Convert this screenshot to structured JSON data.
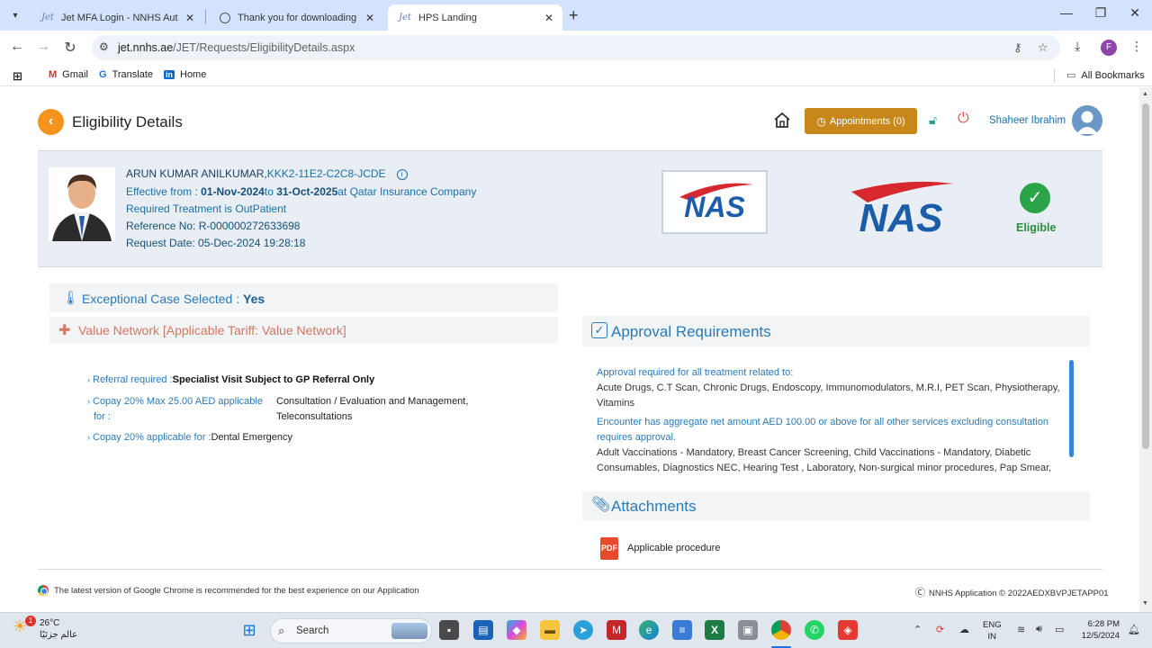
{
  "browser": {
    "tabs": [
      {
        "label": "Jet MFA Login - NNHS Authenti",
        "favicon": "jet-icon"
      },
      {
        "label": "Thank you for downloading An",
        "favicon": "globe-icon"
      },
      {
        "label": "HPS Landing",
        "favicon": "jet-icon",
        "active": true
      }
    ],
    "url_host": "jet.nnhs.ae",
    "url_path": "/JET/Requests/EligibilityDetails.aspx",
    "profile_initial": "F",
    "bookmarks": [
      {
        "label": "Gmail",
        "icon": "gmail-icon"
      },
      {
        "label": "Translate",
        "icon": "translate-icon"
      },
      {
        "label": "Home",
        "icon": "linkedin-icon"
      }
    ],
    "all_bookmarks": "All Bookmarks"
  },
  "header": {
    "title": "Eligibility Details",
    "appointments_label": "Appointments (0)",
    "user_name": "Shaheer Ibrahim"
  },
  "patient": {
    "name": "ARUN KUMAR ANILKUMAR,",
    "card_id": "KKK2-11E2-C2C8-JCDE",
    "effective_prefix": "Effective from : ",
    "effective_from": "01-Nov-2024",
    "to_word": "to ",
    "effective_to": "31-Oct-2025",
    "insurer": "at Qatar Insurance Company",
    "treatment": "Required Treatment is OutPatient",
    "reference": "Reference No: R-000000272633698",
    "request_date": "Request Date: 05-Dec-2024 19:28:18",
    "logo_text": "NAS",
    "status": "Eligible"
  },
  "exceptional": {
    "label": "Exceptional Case Selected : ",
    "value": "Yes"
  },
  "value_network": {
    "label": "Value Network [Applicable Tariff: Value Network]"
  },
  "rules": [
    {
      "label": "Referral required :",
      "value": "Specialist Visit Subject to GP Referral Only"
    },
    {
      "label_line1": "Copay 20% Max 25.00 AED applicable",
      "label_line2": "for :",
      "value_line1": "Consultation / Evaluation and Management,",
      "value_line2": "Teleconsultations"
    },
    {
      "label": "Copay 20% applicable for :",
      "value": "Dental Emergency"
    }
  ],
  "approval": {
    "title": "Approval Requirements",
    "p1": "Approval required for all treatment related to:",
    "p2": "Acute Drugs, C.T Scan, Chronic Drugs, Endoscopy, Immunomodulators, M.R.I, PET Scan, Physiotherapy, Vitamins",
    "p3": "Encounter has aggregate net amount AED 100.00 or above for all other services excluding consultation requires approval.",
    "p4": "Adult Vaccinations - Mandatory, Breast Cancer Screening, Child Vaccinations - Mandatory, Diabetic Consumables, Diagnostics NEC, Hearing Test , Laboratory, Non-surgical minor procedures, Pap Smear,"
  },
  "attachments": {
    "title": "Attachments",
    "file_icon": "PDF",
    "file": "Applicable procedure"
  },
  "footer": {
    "left": "The latest version of Google Chrome is recommended for the best experience on our Application",
    "right": "NNHS Application © 2022AEDXBVPJETAPP01"
  },
  "taskbar": {
    "temperature": "26°C",
    "weather_sub": "عالم جزئيًا",
    "weather_badge": "1",
    "search": "Search",
    "lang1": "ENG",
    "lang2": "IN",
    "time": "6:28 PM",
    "date": "12/5/2024"
  }
}
